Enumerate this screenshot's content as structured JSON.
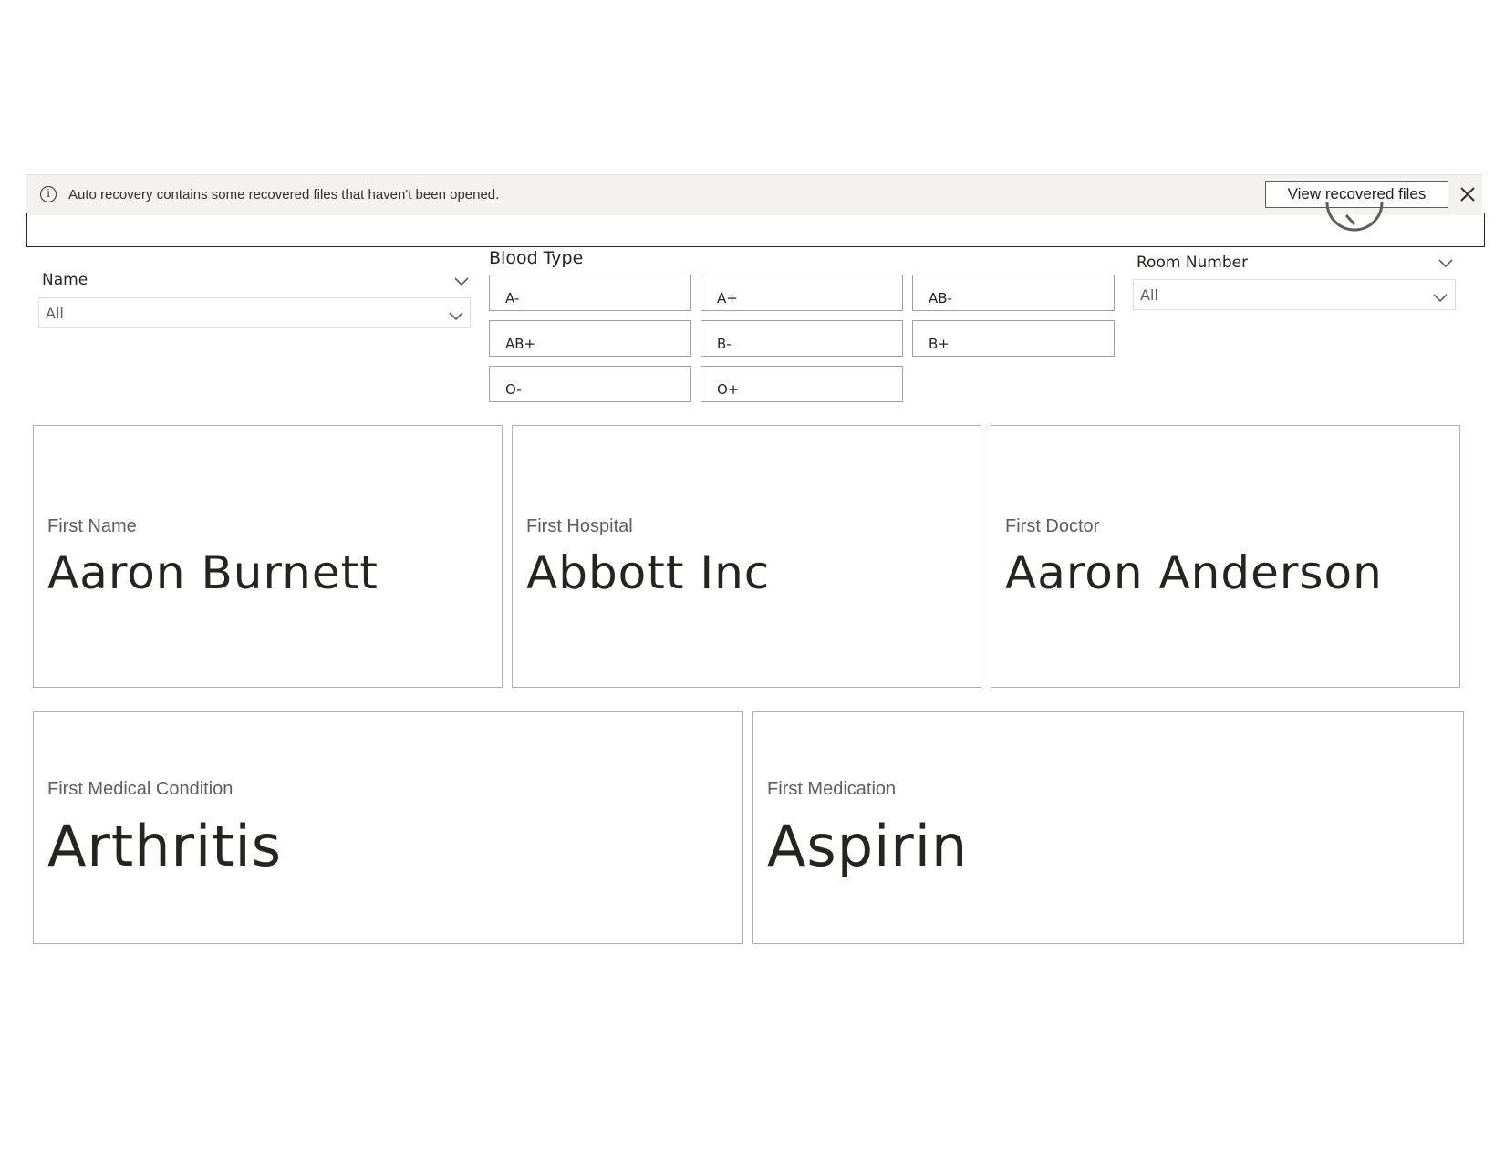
{
  "notification": {
    "message": "Auto recovery contains some recovered files that haven't been opened.",
    "button_label": "View recovered files",
    "info_glyph": "i"
  },
  "slicers": {
    "name": {
      "title": "Name",
      "value": "All"
    },
    "room": {
      "title": "Room Number",
      "value": "All"
    },
    "blood_type": {
      "title": "Blood Type",
      "options": [
        "A-",
        "A+",
        "AB-",
        "AB+",
        "B-",
        "B+",
        "O-",
        "O+"
      ]
    }
  },
  "cards": {
    "first_name": {
      "label": "First Name",
      "value": "Aaron Burnett"
    },
    "first_hospital": {
      "label": "First Hospital",
      "value": "Abbott Inc"
    },
    "first_doctor": {
      "label": "First Doctor",
      "value": "Aaron Anderson"
    },
    "first_condition": {
      "label": "First Medical Condition",
      "value": "Arthritis"
    },
    "first_medication": {
      "label": "First Medication",
      "value": "Aspirin"
    }
  },
  "icons": {
    "info": "info-circle-icon",
    "close": "close-icon",
    "chevron": "chevron-down-icon",
    "clock": "clock-icon"
  },
  "colors": {
    "notification_bg": "#f3f2f1",
    "card_border": "#b3b0ad",
    "text": "#252423",
    "muted": "#605e5c"
  }
}
